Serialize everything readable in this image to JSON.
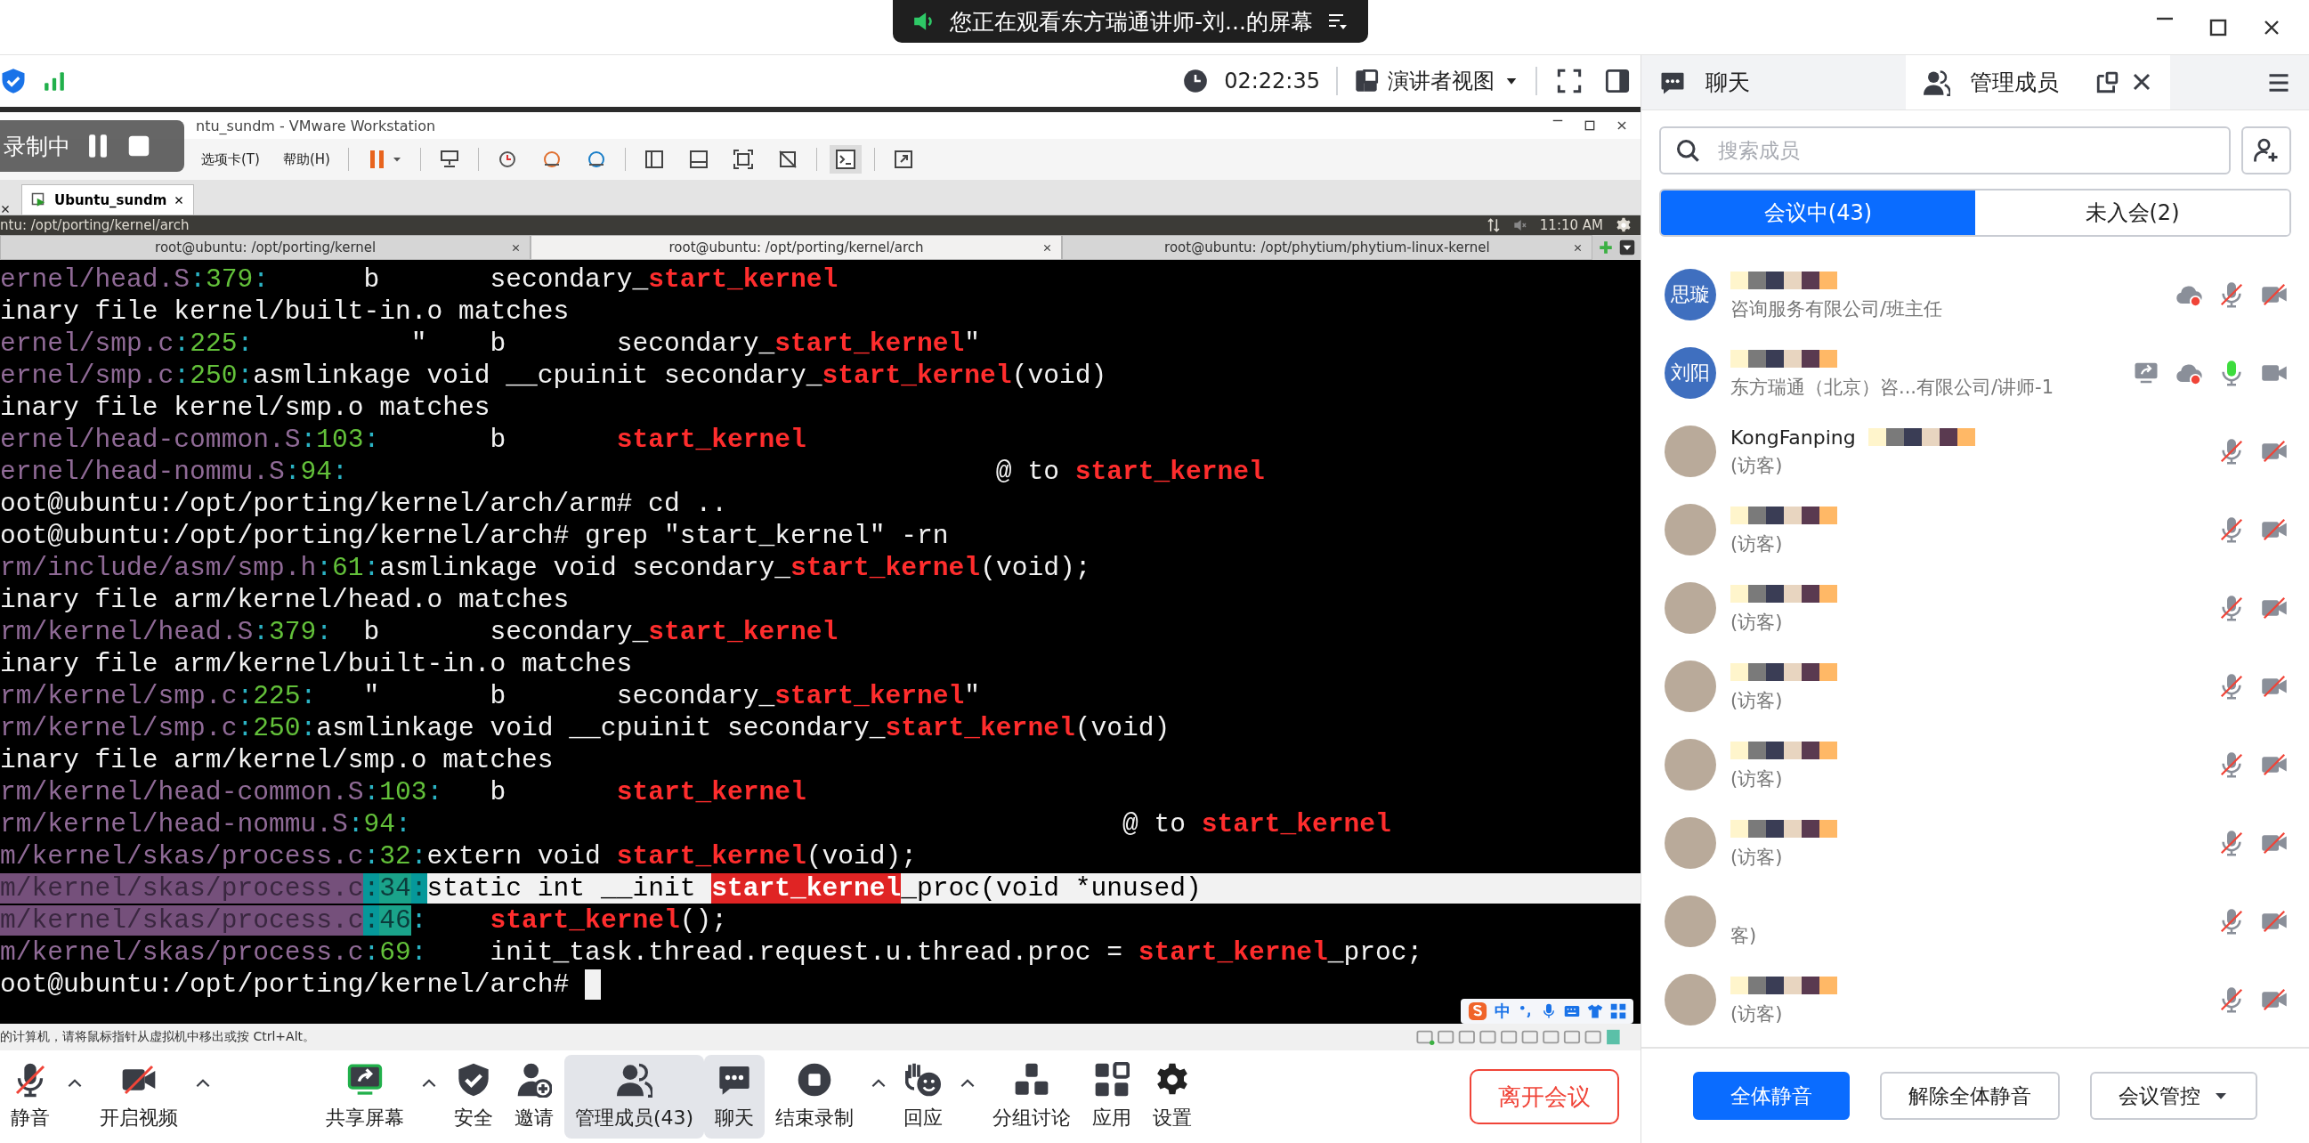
{
  "title_bar": {
    "share_notice": "您正在观看东方瑞通讲师-刘...的屏幕"
  },
  "meeting_bar": {
    "timer": "02:22:35",
    "view_mode": "演讲者视图"
  },
  "recording_overlay": {
    "label": "录制中"
  },
  "vmware": {
    "title": "ntu_sundm - VMware Workstation",
    "menu": [
      "选项卡(T)",
      "帮助(H)"
    ],
    "tabs": [
      {
        "label": "Ubuntu_sundm",
        "selected": true
      }
    ],
    "guest_bar": {
      "title": "ntu: /opt/porting/kernel/arch",
      "time": "11:10 AM"
    },
    "terminal_tabs": [
      {
        "label": "root@ubuntu: /opt/porting/kernel",
        "selected": false
      },
      {
        "label": "root@ubuntu: /opt/porting/kernel/arch",
        "selected": true
      },
      {
        "label": "root@ubuntu: /opt/phytium/phytium-linux-kernel",
        "selected": false
      }
    ],
    "terminal_lines": [
      {
        "segments": [
          {
            "kind": "file",
            "text": "ernel/head.S"
          },
          {
            "kind": "sep",
            "text": ":"
          },
          {
            "kind": "num",
            "text": "379"
          },
          {
            "kind": "sep",
            "text": ":"
          },
          {
            "kind": "text",
            "text": "      b       secondary_"
          },
          {
            "kind": "match",
            "text": "start_kernel"
          }
        ]
      },
      {
        "segments": [
          {
            "kind": "text",
            "text": "inary file kernel/built-in.o matches"
          }
        ]
      },
      {
        "segments": [
          {
            "kind": "file",
            "text": "ernel/smp.c"
          },
          {
            "kind": "sep",
            "text": ":"
          },
          {
            "kind": "num",
            "text": "225"
          },
          {
            "kind": "sep",
            "text": ":"
          },
          {
            "kind": "text",
            "text": "          \"    b       secondary_"
          },
          {
            "kind": "match",
            "text": "start_kernel"
          },
          {
            "kind": "text",
            "text": "\""
          }
        ]
      },
      {
        "segments": [
          {
            "kind": "file",
            "text": "ernel/smp.c"
          },
          {
            "kind": "sep",
            "text": ":"
          },
          {
            "kind": "num",
            "text": "250"
          },
          {
            "kind": "sep",
            "text": ":"
          },
          {
            "kind": "text",
            "text": "asmlinkage void __cpuinit secondary_"
          },
          {
            "kind": "match",
            "text": "start_kernel"
          },
          {
            "kind": "text",
            "text": "(void)"
          }
        ]
      },
      {
        "segments": [
          {
            "kind": "text",
            "text": "inary file kernel/smp.o matches"
          }
        ]
      },
      {
        "segments": [
          {
            "kind": "file",
            "text": "ernel/head-common.S"
          },
          {
            "kind": "sep",
            "text": ":"
          },
          {
            "kind": "num",
            "text": "103"
          },
          {
            "kind": "sep",
            "text": ":"
          },
          {
            "kind": "text",
            "text": "       b       "
          },
          {
            "kind": "match",
            "text": "start_kernel"
          }
        ]
      },
      {
        "segments": [
          {
            "kind": "file",
            "text": "ernel/head-nommu.S"
          },
          {
            "kind": "sep",
            "text": ":"
          },
          {
            "kind": "num",
            "text": "94"
          },
          {
            "kind": "sep",
            "text": ":"
          },
          {
            "kind": "text",
            "text": "                                         @ to "
          },
          {
            "kind": "match",
            "text": "start_kernel"
          }
        ]
      },
      {
        "segments": [
          {
            "kind": "text",
            "text": "oot@ubuntu:/opt/porting/kernel/arch/arm# cd .."
          }
        ]
      },
      {
        "segments": [
          {
            "kind": "text",
            "text": "oot@ubuntu:/opt/porting/kernel/arch# grep \"start_kernel\" -rn"
          }
        ]
      },
      {
        "segments": [
          {
            "kind": "file",
            "text": "rm/include/asm/smp.h"
          },
          {
            "kind": "sep",
            "text": ":"
          },
          {
            "kind": "num",
            "text": "61"
          },
          {
            "kind": "sep",
            "text": ":"
          },
          {
            "kind": "text",
            "text": "asmlinkage void secondary_"
          },
          {
            "kind": "match",
            "text": "start_kernel"
          },
          {
            "kind": "text",
            "text": "(void);"
          }
        ]
      },
      {
        "segments": [
          {
            "kind": "text",
            "text": "inary file arm/kernel/head.o matches"
          }
        ]
      },
      {
        "segments": [
          {
            "kind": "file",
            "text": "rm/kernel/head.S"
          },
          {
            "kind": "sep",
            "text": ":"
          },
          {
            "kind": "num",
            "text": "379"
          },
          {
            "kind": "sep",
            "text": ":"
          },
          {
            "kind": "text",
            "text": "  b       secondary_"
          },
          {
            "kind": "match",
            "text": "start_kernel"
          }
        ]
      },
      {
        "segments": [
          {
            "kind": "text",
            "text": "inary file arm/kernel/built-in.o matches"
          }
        ]
      },
      {
        "segments": [
          {
            "kind": "file",
            "text": "rm/kernel/smp.c"
          },
          {
            "kind": "sep",
            "text": ":"
          },
          {
            "kind": "num",
            "text": "225"
          },
          {
            "kind": "sep",
            "text": ":"
          },
          {
            "kind": "text",
            "text": "   \"       b       secondary_"
          },
          {
            "kind": "match",
            "text": "start_kernel"
          },
          {
            "kind": "text",
            "text": "\""
          }
        ]
      },
      {
        "segments": [
          {
            "kind": "file",
            "text": "rm/kernel/smp.c"
          },
          {
            "kind": "sep",
            "text": ":"
          },
          {
            "kind": "num",
            "text": "250"
          },
          {
            "kind": "sep",
            "text": ":"
          },
          {
            "kind": "text",
            "text": "asmlinkage void __cpuinit secondary_"
          },
          {
            "kind": "match",
            "text": "start_kernel"
          },
          {
            "kind": "text",
            "text": "(void)"
          }
        ]
      },
      {
        "segments": [
          {
            "kind": "text",
            "text": "inary file arm/kernel/smp.o matches"
          }
        ]
      },
      {
        "segments": [
          {
            "kind": "file",
            "text": "rm/kernel/head-common.S"
          },
          {
            "kind": "sep",
            "text": ":"
          },
          {
            "kind": "num",
            "text": "103"
          },
          {
            "kind": "sep",
            "text": ":"
          },
          {
            "kind": "text",
            "text": "   b       "
          },
          {
            "kind": "match",
            "text": "start_kernel"
          }
        ]
      },
      {
        "segments": [
          {
            "kind": "file",
            "text": "rm/kernel/head-nommu.S"
          },
          {
            "kind": "sep",
            "text": ":"
          },
          {
            "kind": "num",
            "text": "94"
          },
          {
            "kind": "sep",
            "text": ":"
          },
          {
            "kind": "text",
            "text": "                                             @ to "
          },
          {
            "kind": "match",
            "text": "start_kernel"
          }
        ]
      },
      {
        "segments": [
          {
            "kind": "file",
            "text": "m/kernel/skas/process.c"
          },
          {
            "kind": "sep",
            "text": ":"
          },
          {
            "kind": "num",
            "text": "32"
          },
          {
            "kind": "sep",
            "text": ":"
          },
          {
            "kind": "text",
            "text": "extern void "
          },
          {
            "kind": "match",
            "text": "start_kernel"
          },
          {
            "kind": "text",
            "text": "(void);"
          }
        ]
      },
      {
        "segments": [
          {
            "kind": "hl-file",
            "text": "m/kernel/skas/process.c"
          },
          {
            "kind": "hl-sep",
            "text": ":"
          },
          {
            "kind": "hl-num",
            "text": "34"
          },
          {
            "kind": "hl-sep",
            "text": ":"
          },
          {
            "kind": "hl-text",
            "text": "static int __init "
          },
          {
            "kind": "hl-match",
            "text": "start_kernel"
          },
          {
            "kind": "hl-text",
            "text": "_proc(void *unused)                                     "
          }
        ]
      },
      {
        "segments": [
          {
            "kind": "hl-file",
            "text": "m/kernel/skas/process.c"
          },
          {
            "kind": "hl-sep",
            "text": ":"
          },
          {
            "kind": "hl-num",
            "text": "46"
          },
          {
            "kind": "sep",
            "text": ":    "
          },
          {
            "kind": "match",
            "text": "start_kernel"
          },
          {
            "kind": "text",
            "text": "();"
          }
        ]
      },
      {
        "segments": [
          {
            "kind": "file",
            "text": "m/kernel/skas/process.c"
          },
          {
            "kind": "sep",
            "text": ":"
          },
          {
            "kind": "num",
            "text": "69"
          },
          {
            "kind": "sep",
            "text": ":"
          },
          {
            "kind": "text",
            "text": "    init_task.thread.request.u.thread.proc = "
          },
          {
            "kind": "match",
            "text": "start_kernel"
          },
          {
            "kind": "text",
            "text": "_proc;"
          }
        ]
      },
      {
        "segments": [
          {
            "kind": "text",
            "text": "oot@ubuntu:/opt/porting/kernel/arch# "
          },
          {
            "kind": "cursor"
          }
        ]
      }
    ],
    "ime": {
      "mode": "中"
    },
    "status_text": "的计算机，请将鼠标指针从虚拟机中移出或按 Ctrl+Alt。"
  },
  "toolbar": {
    "left_tools": [
      {
        "kind": "mic",
        "label": "静音",
        "caret": true,
        "active": false
      },
      {
        "kind": "video",
        "label": "开启视频",
        "caret": true,
        "active": false
      }
    ],
    "tools": [
      {
        "kind": "share",
        "label": "共享屏幕",
        "caret": true,
        "active": false
      },
      {
        "kind": "security",
        "label": "安全",
        "caret": false,
        "active": false
      },
      {
        "kind": "invite",
        "label": "邀请",
        "caret": false,
        "active": false
      },
      {
        "kind": "members",
        "label": "管理成员(43)",
        "caret": false,
        "active": true
      },
      {
        "kind": "chat",
        "label": "聊天",
        "caret": false,
        "active": true
      },
      {
        "kind": "record",
        "label": "结束录制",
        "caret": true,
        "active": false
      },
      {
        "kind": "reaction",
        "label": "回应",
        "caret": true,
        "active": false
      },
      {
        "kind": "breakout",
        "label": "分组讨论",
        "caret": false,
        "active": false
      },
      {
        "kind": "apps",
        "label": "应用",
        "caret": false,
        "active": false
      },
      {
        "kind": "settings",
        "label": "设置",
        "caret": false,
        "active": false
      }
    ],
    "leave_button": "离开会议"
  },
  "panel": {
    "tabs": [
      {
        "kind": "chat",
        "label": "聊天",
        "selected": false
      },
      {
        "kind": "members",
        "label": "管理成员",
        "selected": true
      }
    ],
    "search": {
      "placeholder": "搜索成员"
    },
    "segments": [
      {
        "label": "会议中(43)",
        "selected": true
      },
      {
        "label": "未入会(2)",
        "selected": false
      }
    ],
    "members": [
      {
        "kind": "initials",
        "initials": "思璇",
        "subtitle": "咨询服务有限公司/班主任",
        "redacted": true,
        "sharing": false,
        "cloud_recording": true,
        "mic_on": false,
        "camera_on": false
      },
      {
        "kind": "initials",
        "initials": "刘阳",
        "subtitle": "东方瑞通（北京）咨...有限公司/讲师-1",
        "redacted": true,
        "sharing": true,
        "cloud_recording": true,
        "mic_on": true,
        "camera_on": true
      },
      {
        "kind": "photo",
        "name": "KongFanping",
        "subtitle": "(访客)",
        "redacted": true,
        "sharing": false,
        "cloud_recording": false,
        "mic_on": false,
        "camera_on": false
      },
      {
        "kind": "photo",
        "subtitle": "(访客)",
        "redacted": true,
        "sharing": false,
        "cloud_recording": false,
        "mic_on": false,
        "camera_on": false
      },
      {
        "kind": "photo",
        "subtitle": "(访客)",
        "redacted": true,
        "sharing": false,
        "cloud_recording": false,
        "mic_on": false,
        "camera_on": false
      },
      {
        "kind": "photo",
        "subtitle": "(访客)",
        "redacted": true,
        "sharing": false,
        "cloud_recording": false,
        "mic_on": false,
        "camera_on": false
      },
      {
        "kind": "photo",
        "subtitle": "(访客)",
        "redacted": true,
        "sharing": false,
        "cloud_recording": false,
        "mic_on": false,
        "camera_on": false
      },
      {
        "kind": "photo",
        "subtitle": "(访客)",
        "redacted": true,
        "sharing": false,
        "cloud_recording": false,
        "mic_on": false,
        "camera_on": false
      },
      {
        "kind": "photo",
        "subtitle": "客)",
        "redacted": false,
        "sharing": false,
        "cloud_recording": false,
        "mic_on": false,
        "camera_on": false
      },
      {
        "kind": "photo",
        "subtitle": "(访客)",
        "redacted": true,
        "sharing": false,
        "cloud_recording": false,
        "mic_on": false,
        "camera_on": false
      }
    ],
    "buttons": [
      {
        "kind": "primary",
        "label": "全体静音"
      },
      {
        "kind": "default",
        "label": "解除全体静音"
      },
      {
        "kind": "dropdown",
        "label": "会议管控"
      }
    ]
  }
}
